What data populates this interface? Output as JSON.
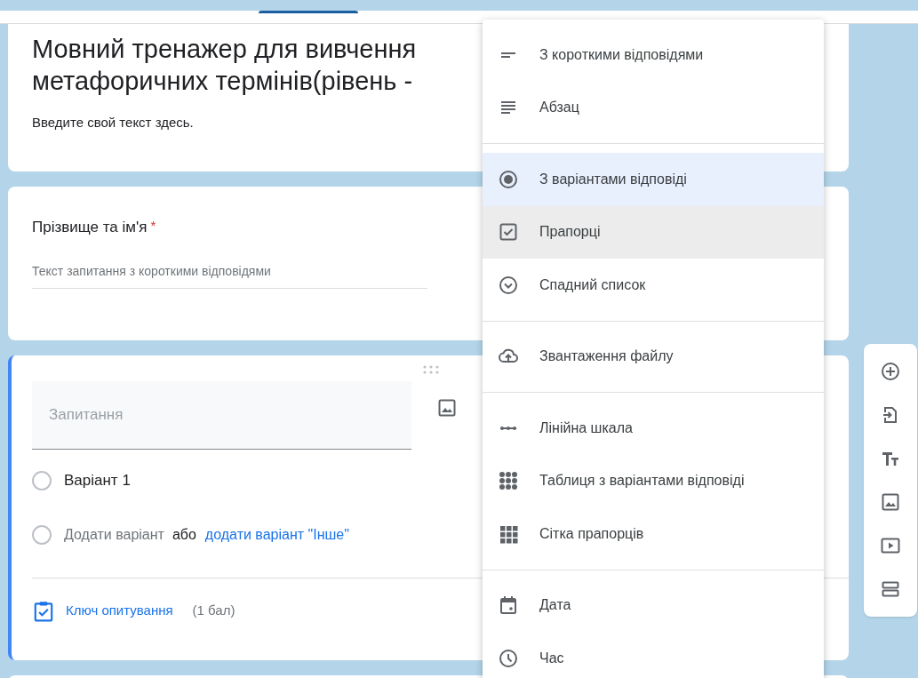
{
  "title_card": {
    "title_lines": [
      "Мовний тренажер для вивчення",
      "метафоричних термінів(рівень -"
    ],
    "description": "Введите свой текст здесь."
  },
  "question_card": {
    "title": "Прізвище та ім'я",
    "required": true,
    "required_mark": "*",
    "placeholder": "Текст запитання з короткими відповідями"
  },
  "edit_card": {
    "question_placeholder": "Запитання",
    "options": [
      {
        "label": "Варіант 1",
        "checked": false
      }
    ],
    "add_option_checked": false,
    "add_option": "Додати варіант",
    "or": "або",
    "add_other": "додати варіант \"Інше\"",
    "answer_key": "Ключ опитування",
    "points": "(1 бал)"
  },
  "type_menu": {
    "groups": [
      {
        "items": [
          {
            "kind": "short",
            "label": "З короткими відповідями",
            "selected": false,
            "hovered": false
          },
          {
            "kind": "paragraph",
            "label": "Абзац",
            "selected": false,
            "hovered": false
          }
        ]
      },
      {
        "items": [
          {
            "kind": "radio",
            "label": "З варіантами відповіді",
            "selected": true,
            "hovered": false
          },
          {
            "kind": "checkbox",
            "label": "Прапорці",
            "selected": false,
            "hovered": true
          },
          {
            "kind": "dropdown",
            "label": "Спадний список",
            "selected": false,
            "hovered": false
          }
        ]
      },
      {
        "items": [
          {
            "kind": "upload",
            "label": "Звантаження файлу",
            "selected": false,
            "hovered": false
          }
        ]
      },
      {
        "items": [
          {
            "kind": "scale",
            "label": "Лінійна шкала",
            "selected": false,
            "hovered": false
          },
          {
            "kind": "grid",
            "label": "Таблиця з варіантами відповіді",
            "selected": false,
            "hovered": false
          },
          {
            "kind": "checkgrid",
            "label": "Сітка прапорців",
            "selected": false,
            "hovered": false
          }
        ]
      },
      {
        "items": [
          {
            "kind": "date",
            "label": "Дата",
            "selected": false,
            "hovered": false
          },
          {
            "kind": "time",
            "label": "Час",
            "selected": false,
            "hovered": false
          }
        ]
      }
    ]
  },
  "toolbar": {
    "buttons": [
      {
        "kind": "add"
      },
      {
        "kind": "import"
      },
      {
        "kind": "text"
      },
      {
        "kind": "image"
      },
      {
        "kind": "video"
      },
      {
        "kind": "section"
      }
    ]
  }
}
